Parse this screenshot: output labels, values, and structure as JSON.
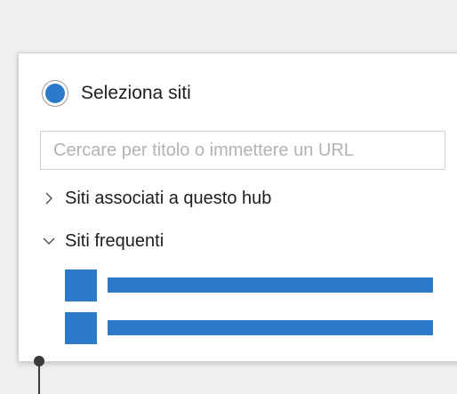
{
  "selector": {
    "radio_label": "Seleziona siti",
    "radio_selected": true,
    "search_placeholder": "Cercare per titolo o immettere un URL",
    "search_value": ""
  },
  "tree": [
    {
      "label": "Siti associati a questo hub",
      "expanded": false,
      "icon": "chevron-right-icon"
    },
    {
      "label": "Siti frequenti",
      "expanded": true,
      "icon": "chevron-down-icon"
    }
  ],
  "colors": {
    "accent": "#2a7ac9",
    "background": "#efefef",
    "panel": "#ffffff",
    "connector": "#3b3b3b"
  }
}
